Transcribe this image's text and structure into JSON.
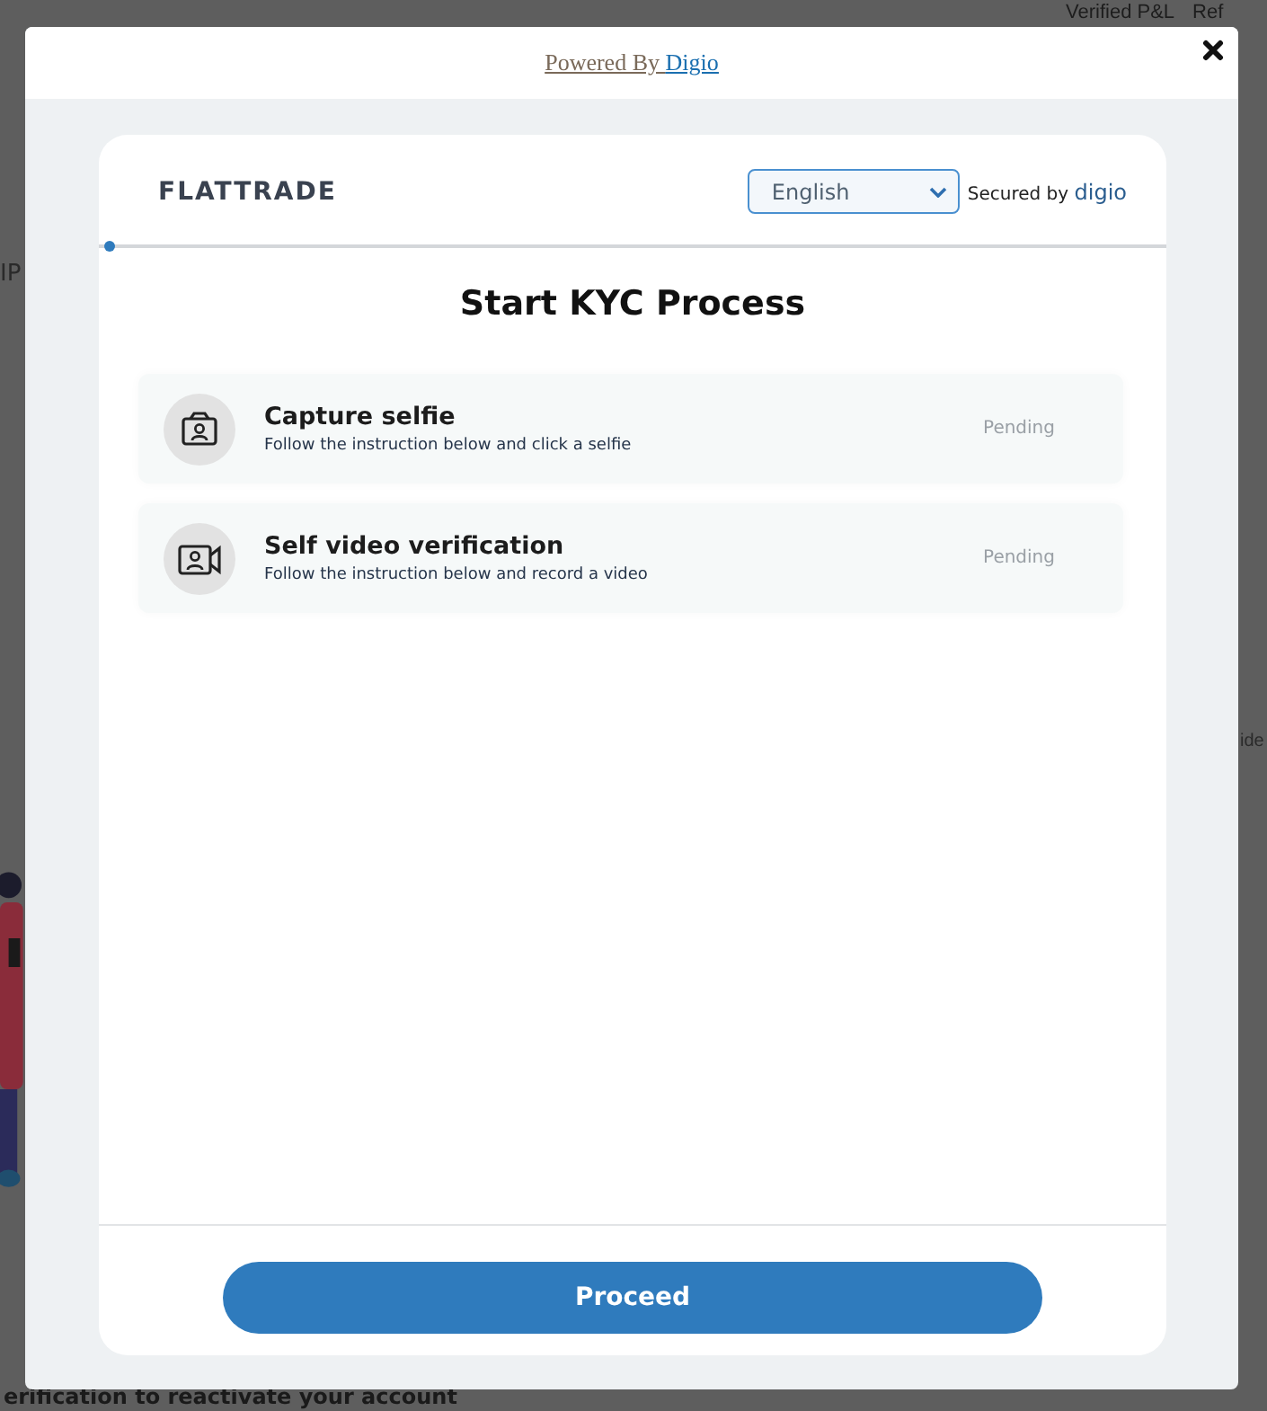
{
  "background_page": {
    "nav_links": [
      "Verified P&L",
      "Ref"
    ],
    "left_fragment": "IP",
    "right_fragment": "ide",
    "bottom_text": "erification to reactivate your account"
  },
  "modal": {
    "powered_by": {
      "text": "Powered By",
      "link": "Digio"
    },
    "header": {
      "logo": "FLATTRADE",
      "language": {
        "value": "English"
      },
      "secured_by": "Secured by",
      "secured_brand": "digio"
    },
    "title": "Start KYC Process",
    "steps": [
      {
        "kind": "selfie",
        "title": "Capture selfie",
        "subtitle": "Follow the instruction below and click a selfie",
        "status": "Pending"
      },
      {
        "kind": "video",
        "title": "Self video verification",
        "subtitle": "Follow the instruction below and record a video",
        "status": "Pending"
      }
    ],
    "button": "Proceed"
  }
}
